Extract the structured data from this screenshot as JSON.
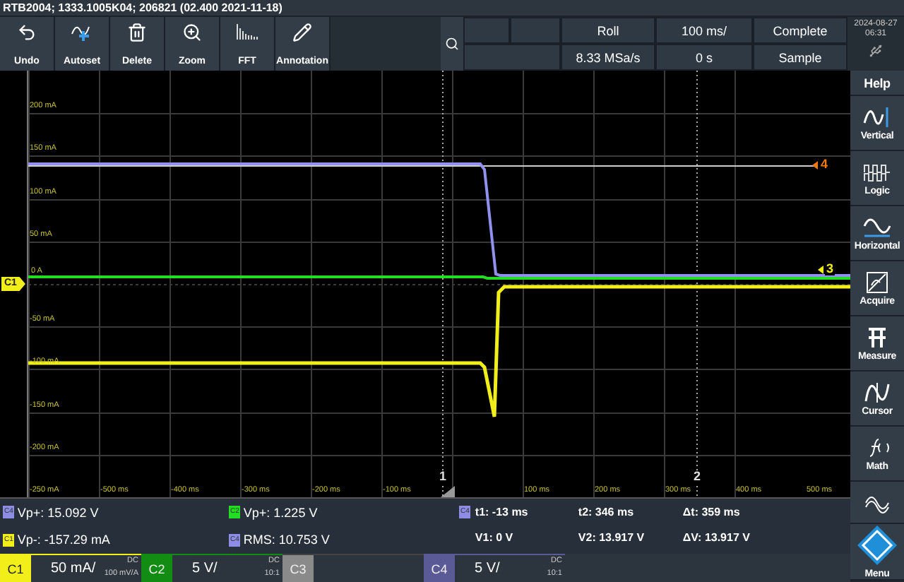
{
  "title_bar": {
    "text": "RTB2004; 1333.1005K04; 206821 (02.400 2021-11-18)"
  },
  "toolbar": [
    {
      "label": "Undo",
      "kind": "undo"
    },
    {
      "label": "Autoset",
      "kind": "autoset"
    },
    {
      "label": "Delete",
      "kind": "delete"
    },
    {
      "label": "Zoom",
      "kind": "zoom"
    },
    {
      "label": "FFT",
      "kind": "fft"
    },
    {
      "label": "Annotation",
      "kind": "annotation"
    }
  ],
  "acquisition": {
    "mode": "Roll",
    "time_scale": "100 ms/",
    "status": "Complete",
    "sample_rate": "8.33 MSa/s",
    "time_offset": "0 s",
    "acq_type": "Sample"
  },
  "clock": {
    "date": "2024-08-27",
    "time": "06:31"
  },
  "plot": {
    "y_labels": [
      "200 mA",
      "150 mA",
      "100 mA",
      "50 mA",
      "0 A",
      "-50 mA",
      "-100 mA",
      "-150 mA",
      "-200 mA",
      "-250 mA"
    ],
    "x_labels": [
      "-500 ms",
      "-400 ms",
      "-300 ms",
      "-200 ms",
      "-100 ms",
      "100 ms",
      "200 ms",
      "300 ms",
      "400 ms",
      "500 ms"
    ],
    "channel_tag": {
      "text": "C1",
      "color": "#f2ee1a"
    },
    "level_markers": [
      {
        "text": "4",
        "color": "#f07a10"
      },
      {
        "text": "3",
        "color": "#f2ee1a"
      }
    ],
    "cursor_markers": [
      "1",
      "2"
    ]
  },
  "measurements": [
    {
      "channel": "C4",
      "color": "#8d8de6",
      "text": "Vp+: 15.092 V"
    },
    {
      "channel": "C2",
      "color": "#22dd22",
      "text": "Vp+: 1.225 V"
    },
    {
      "channel": "C1",
      "color": "#f2ee1a",
      "text": "Vp-: -157.29 mA"
    },
    {
      "channel": "C4",
      "color": "#8d8de6",
      "text": "RMS: 10.753 V"
    }
  ],
  "cursor": {
    "channel": "C4",
    "color": "#8d8de6",
    "values": [
      "t1: -13 ms",
      "t2: 346 ms",
      "Δt: 359 ms",
      "V1: 0 V",
      "V2: 13.917 V",
      "ΔV: 13.917 V"
    ]
  },
  "channels": [
    {
      "name": "C1",
      "color": "#f2ee1a",
      "enabled": true,
      "scale": "50 mA/",
      "coupling": "DC",
      "probe": "100 mV/A"
    },
    {
      "name": "C2",
      "color": "#138c13",
      "enabled": true,
      "scale": "5 V/",
      "coupling": "DC",
      "probe": "10:1"
    },
    {
      "name": "C3",
      "color": "#8a8a8a",
      "enabled": false
    },
    {
      "name": "C4",
      "color": "#5a5a96",
      "enabled": true,
      "scale": "5 V/",
      "coupling": "DC",
      "probe": "10:1"
    }
  ],
  "sidebar": [
    {
      "label": "Help",
      "kind": "help"
    },
    {
      "label": "Vertical",
      "kind": "vertical"
    },
    {
      "label": "Logic",
      "kind": "logic"
    },
    {
      "label": "Horizontal",
      "kind": "horizontal"
    },
    {
      "label": "Acquire",
      "kind": "acquire"
    },
    {
      "label": "Measure",
      "kind": "measure"
    },
    {
      "label": "Cursor",
      "kind": "cursor"
    },
    {
      "label": "Math",
      "kind": "math"
    },
    {
      "kind": "bus"
    },
    {
      "label": "Menu",
      "kind": "menu"
    }
  ]
}
